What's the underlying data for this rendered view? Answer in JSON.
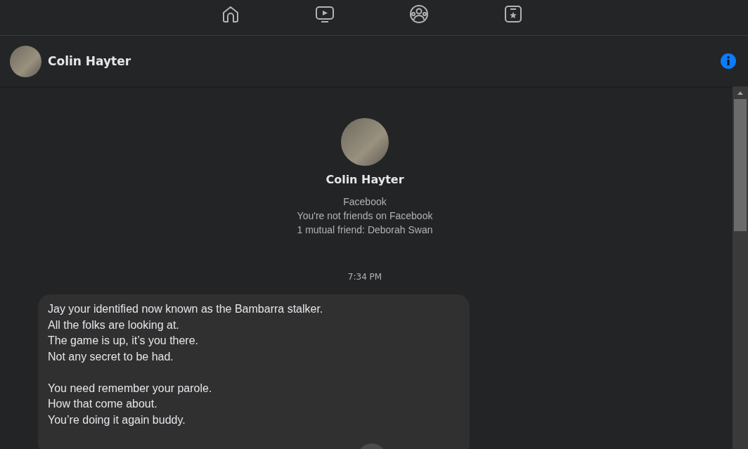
{
  "nav": {
    "icons": [
      {
        "kind": "home"
      },
      {
        "kind": "video"
      },
      {
        "kind": "groups"
      },
      {
        "kind": "gaming"
      }
    ]
  },
  "header": {
    "name": "Colin Hayter"
  },
  "profile": {
    "name": "Colin Hayter",
    "lines": [
      "Facebook",
      "You're not friends on Facebook",
      "1 mutual friend: Deborah Swan"
    ]
  },
  "timestamp": "7:34 PM",
  "message": {
    "paragraphs": [
      [
        "Jay your identified now known as the Bambarra stalker.",
        "All the folks are looking at.",
        "The game is up, it’s you there.",
        "Not any secret to be had."
      ],
      [
        "You need remember your parole.",
        "How that come about.",
        "You’re doing it again buddy."
      ]
    ]
  }
}
